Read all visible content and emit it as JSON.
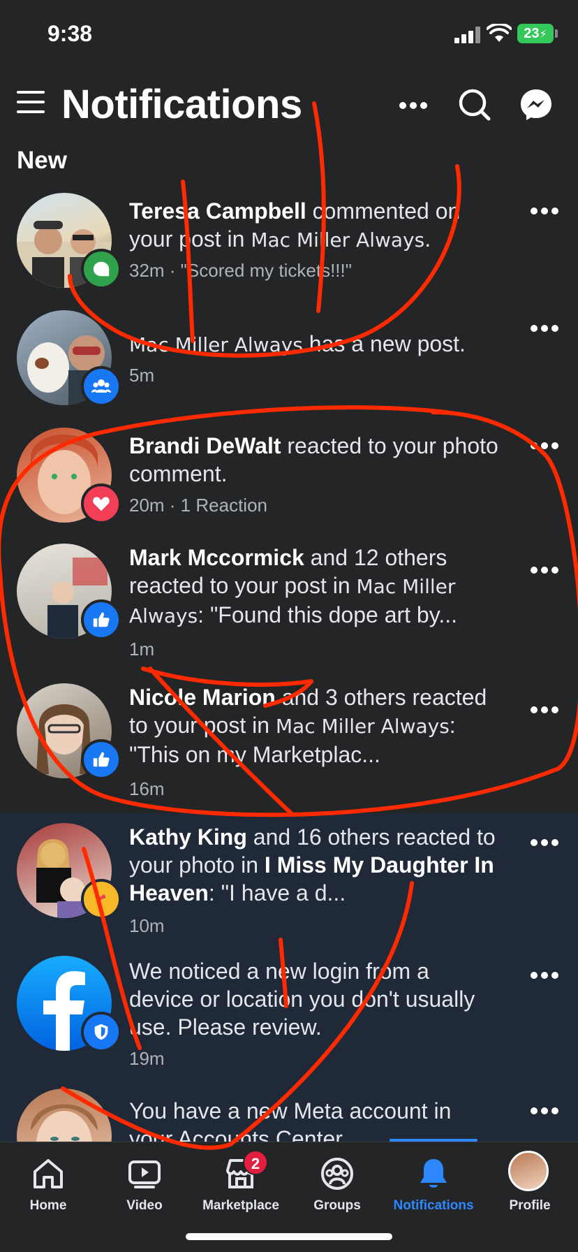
{
  "status_bar": {
    "time": "9:38",
    "battery": "23"
  },
  "header": {
    "title": "Notifications"
  },
  "section": {
    "new_label": "New"
  },
  "notifications": [
    {
      "actor": "Teresa Campbell",
      "text": " commented on your post in ",
      "group": "Mac Miller Always",
      "suffix": ".",
      "meta": "32m · \"Scored my tickets!!!\"",
      "badge": "comment-icon",
      "badge_color": "#31a24c"
    },
    {
      "actor": "",
      "text": "",
      "group": "Mac Miller Always",
      "suffix": " has a new post.",
      "meta": "5m",
      "badge": "groups-icon",
      "badge_color": "#1877f2"
    },
    {
      "actor": "Brandi DeWalt",
      "text": " reacted to your photo comment.",
      "group": "",
      "suffix": "",
      "meta": "20m · 1 Reaction",
      "badge": "heart-icon",
      "badge_color": "#f33e58"
    },
    {
      "actor": "Mark Mccormick",
      "text": " and 12 others reacted to your post in ",
      "group": "Mac Miller Always",
      "suffix": ": \"Found this dope art by...",
      "meta": "1m",
      "badge": "like-icon",
      "badge_color": "#1877f2"
    },
    {
      "actor": "Nicole Marion",
      "text": " and 3 others reacted to your post in ",
      "group": "Mac Miller Always",
      "suffix": ": \"This on my Marketplac...",
      "meta": "16m",
      "badge": "like-icon",
      "badge_color": "#1877f2"
    },
    {
      "actor": "Kathy King",
      "text": " and 16 others reacted to your photo in ",
      "group": "I Miss My Daughter In Heaven",
      "suffix": ": \"I have a d...",
      "meta": "10m",
      "badge": "care-reaction-icon",
      "badge_color": "#f7b928"
    },
    {
      "actor": "",
      "text": "We noticed a new login from a device or location you don't usually use. Please review.",
      "group": "",
      "suffix": "",
      "meta": "19m",
      "badge": "shield-icon",
      "badge_color": "#1877f2"
    },
    {
      "actor": "",
      "text": "You have a new Meta account in your Accounts Center.",
      "group": "",
      "suffix": "",
      "meta": "",
      "badge": "",
      "badge_color": ""
    }
  ],
  "tabs": [
    {
      "label": "Home",
      "icon": "home-icon"
    },
    {
      "label": "Video",
      "icon": "video-icon"
    },
    {
      "label": "Marketplace",
      "icon": "marketplace-icon",
      "badge": "2"
    },
    {
      "label": "Groups",
      "icon": "groups-icon"
    },
    {
      "label": "Notifications",
      "icon": "bell-icon",
      "active": true
    },
    {
      "label": "Profile",
      "icon": "profile-avatar"
    }
  ],
  "colors": {
    "background": "#242526",
    "read_row": "#1f2937",
    "accent": "#2d88ff",
    "annotation": "#ff2a00"
  }
}
